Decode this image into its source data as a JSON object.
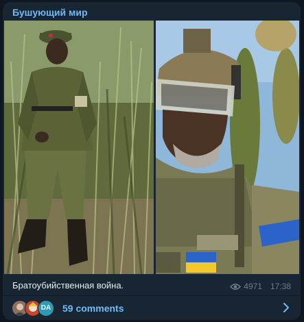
{
  "post": {
    "channel_name": "Бушующий мир",
    "caption": "Братоубийственная война.",
    "views": "4971",
    "time": "17:38",
    "comments_label": "59 comments",
    "avatar_initials": "DA"
  },
  "icons": {
    "views": "eye-icon",
    "open_comments": "chevron-right-icon"
  },
  "colors": {
    "background": "#0e1621",
    "bubble": "#182533",
    "link": "#71baf5",
    "muted": "#6d7f8f"
  }
}
